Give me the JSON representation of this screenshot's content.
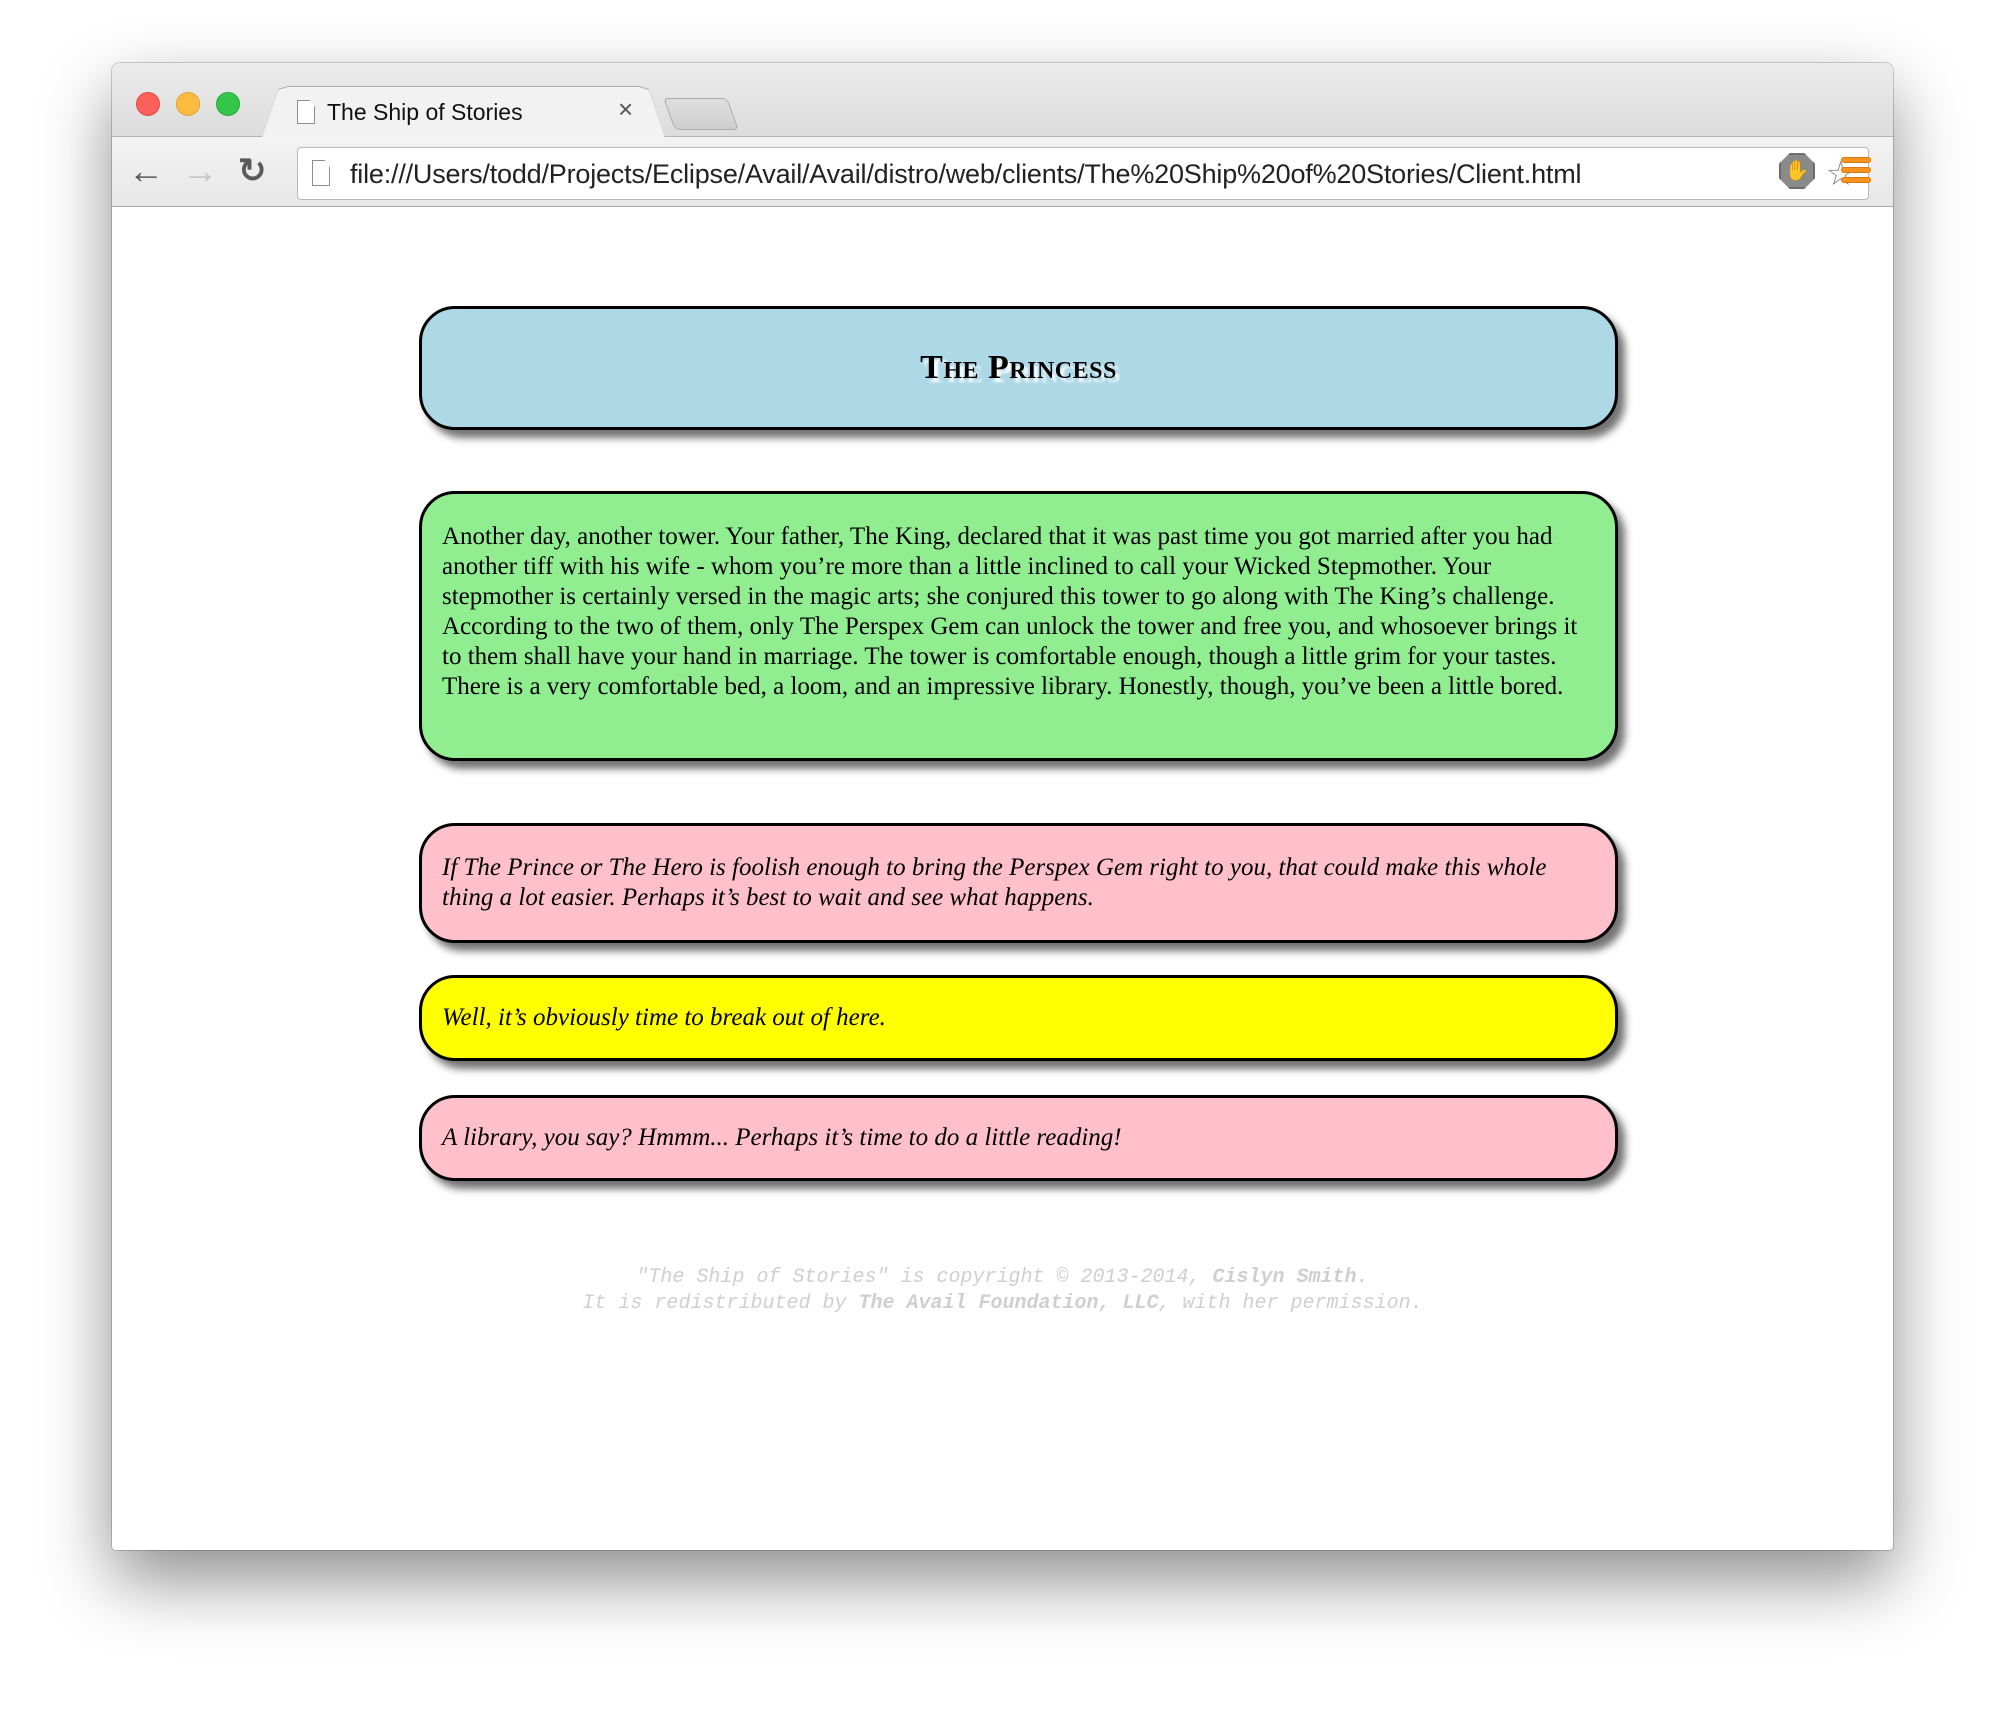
{
  "browser": {
    "tab_title": "The Ship of Stories",
    "tab_close_glyph": "×",
    "url": "file:///Users/todd/Projects/Eclipse/Avail/Avail/distro/web/clients/The%20Ship%20of%20Stories/Client.html",
    "icons": {
      "back": "←",
      "forward": "→",
      "reload": "↻",
      "bookmark_star": "☆",
      "extension": "✋"
    }
  },
  "page": {
    "title": "The Princess",
    "story_text": "Another day, another tower. Your father, The King, declared that it was past time you got married after you had another tiff with his wife - whom you’re more than a little inclined to call your Wicked Stepmother. Your stepmother is certainly versed in the magic arts; she conjured this tower to go along with The King’s challenge. According to the two of them, only The Perspex Gem can unlock the tower and free you, and whosoever brings it to them shall have your hand in marriage. The tower is comfortable enough, though a little grim for your tastes. There is a very comfortable bed, a loom, and an impressive library. Honestly, though, you’ve been a little bored.",
    "choices": [
      {
        "text": "If The Prince or The Hero is foolish enough to bring the Perspex Gem right to you, that could make this whole thing a lot easier. Perhaps it’s best to wait and see what happens.",
        "color": "#ffc0cb"
      },
      {
        "text": "Well, it’s obviously time to break out of here.",
        "color": "#ffff00"
      },
      {
        "text": "A library, you say? Hmmm... Perhaps it’s time to do a little reading!",
        "color": "#ffc0cb"
      }
    ],
    "colors": {
      "title_box": "#add8e6",
      "story_box": "#90ee90"
    }
  },
  "footer": {
    "line1_prefix": "\"The Ship of Stories\" is copyright © 2013-2014, ",
    "line1_author": "Cislyn Smith",
    "line1_suffix": ".",
    "line2_prefix": "It is redistributed by ",
    "line2_org": "The Avail Foundation, LLC",
    "line2_suffix": ", with her permission."
  }
}
